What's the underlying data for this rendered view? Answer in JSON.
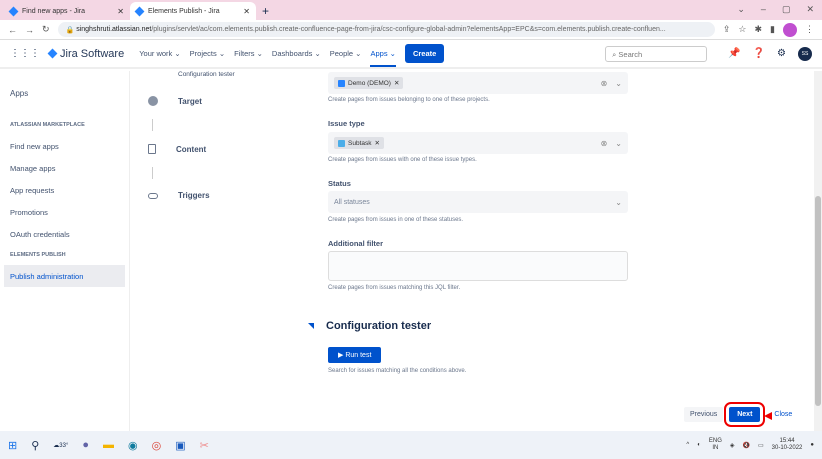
{
  "browser": {
    "tabs": [
      {
        "title": "Find new apps - Jira"
      },
      {
        "title": "Elements Publish - Jira"
      }
    ],
    "url_host": "singhshruti.atlassian.net",
    "url_path": "/plugins/servlet/ac/com.elements.publish.create-confluence-page-from-jira/csc-configure-global-admin?elementsApp=EPC&s=com.elements.publish.create-confluen..."
  },
  "nav": {
    "product": "Jira Software",
    "items": [
      "Your work ⌄",
      "Projects ⌄",
      "Filters ⌄",
      "Dashboards ⌄",
      "People ⌄",
      "Apps ⌄"
    ],
    "create": "Create",
    "search_placeholder": "Search",
    "avatar": "SS"
  },
  "sidebar": {
    "title": "Apps",
    "section1": "ATLASSIAN MARKETPLACE",
    "items1": [
      "Find new apps",
      "Manage apps",
      "App requests",
      "Promotions",
      "OAuth credentials"
    ],
    "section2": "ELEMENTS PUBLISH",
    "items2": [
      "Publish administration"
    ]
  },
  "steps": {
    "partial": "Configuration tester",
    "items": [
      "Target",
      "Content",
      "Triggers"
    ]
  },
  "form": {
    "project": {
      "chip": "Demo (DEMO)",
      "help": "Create pages from issues belonging to one of these projects."
    },
    "issue_type": {
      "label": "Issue type",
      "chip": "Subtask",
      "help": "Create pages from issues with one of these issue types."
    },
    "status": {
      "label": "Status",
      "placeholder": "All statuses",
      "help": "Create pages from issues in one of these statuses."
    },
    "filter": {
      "label": "Additional filter",
      "help": "Create pages from issues matching this JQL filter."
    },
    "tester": {
      "title": "Configuration tester",
      "button": "Run test",
      "help": "Search for issues matching all the conditions above."
    }
  },
  "footer": {
    "previous": "Previous",
    "next": "Next",
    "close": "Close"
  },
  "taskbar": {
    "weather": "33°",
    "lang": "ENG",
    "region": "IN",
    "time": "15:44",
    "date": "30-10-2022"
  }
}
